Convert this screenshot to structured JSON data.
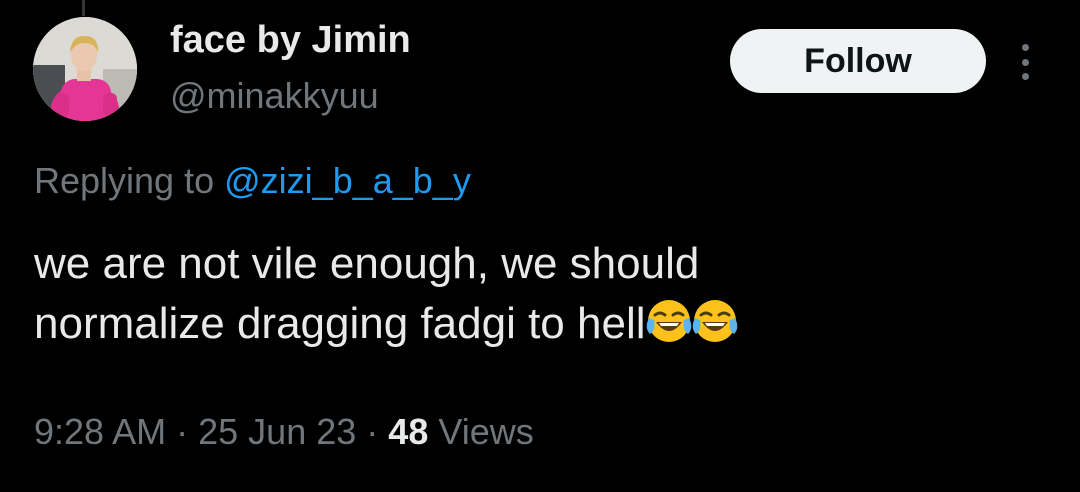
{
  "author": {
    "display_name": "face by Jimin",
    "handle": "@minakkyuu",
    "avatar_icon": "profile-photo"
  },
  "header": {
    "follow_label": "Follow",
    "more_icon": "more-vertical-icon"
  },
  "reply": {
    "prefix": "Replying to",
    "mention": "@zizi_b_a_b_y"
  },
  "tweet": {
    "line1": "we are not vile enough, we should",
    "line2": "normalize dragging fadgi to hell",
    "emojis": [
      "face-with-tears-of-joy",
      "face-with-tears-of-joy"
    ]
  },
  "meta": {
    "time": "9:28 AM",
    "separator": "·",
    "date": "25 Jun 23",
    "views_count": "48",
    "views_label": "Views"
  },
  "colors": {
    "background": "#000000",
    "primary_text": "#e7e9ea",
    "secondary_text": "#71767b",
    "link": "#1d9bf0",
    "follow_bg": "#eff3f4",
    "follow_text": "#0f1419"
  }
}
